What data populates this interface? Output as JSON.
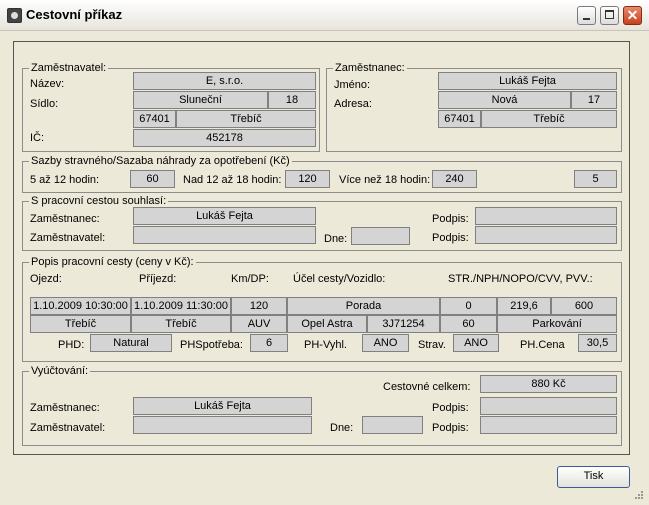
{
  "window": {
    "title": "Cestovní příkaz",
    "close_glyph": "✕"
  },
  "employer": {
    "legend": "Zaměstnavatel:",
    "name_label": "Název:",
    "name": "E, s.r.o.",
    "seat_label": "Sídlo:",
    "street": "Sluneční",
    "number": "18",
    "zip": "67401",
    "city": "Třebíč",
    "ico_label": "IČ:",
    "ico": "452178"
  },
  "employee": {
    "legend": "Zaměstnanec:",
    "name_label": "Jméno:",
    "name": "Lukáš Fejta",
    "address_label": "Adresa:",
    "street": "Nová",
    "number": "17",
    "zip": "67401",
    "city": "Třebíč"
  },
  "rates": {
    "legend": "Sazby stravného/Sazaba náhrady za opotřebení (Kč)",
    "r1_label": "5 až 12 hodin:",
    "r1": "60",
    "r2_label": "Nad 12 až 18 hodin:",
    "r2": "120",
    "r3_label": "Více než 18 hodin:",
    "r3": "240",
    "wear": "5"
  },
  "consent": {
    "legend": "S pracovní cestou souhlasí:",
    "employee_label": "Zaměstnanec:",
    "employee": "Lukáš Fejta",
    "employer_label": "Zaměstnavatel:",
    "employer": "",
    "date_label": "Dne:",
    "date": "",
    "sign1_label": "Podpis:",
    "sign2_label": "Podpis:"
  },
  "trip": {
    "legend": "Popis pracovní cesty (ceny v Kč):",
    "headers": {
      "departure": "Ojezd:",
      "arrival": "Příjezd:",
      "km": "Km/DP:",
      "purpose": "Účel cesty/Vozidlo:",
      "other": "STR./NPH/NOPO/CVV, PVV.:"
    },
    "row1": {
      "departure": "1.10.2009 10:30:00",
      "arrival": "1.10.2009 11:30:00",
      "km": "120",
      "purpose": "Porada",
      "str": "0",
      "nph": "219,6",
      "nopo": "600"
    },
    "row2": {
      "from": "Třebíč",
      "to": "Třebíč",
      "dp": "AUV",
      "car": "Opel Astra",
      "plate": "3J71254",
      "cvv": "60",
      "pvv": "Parkování"
    },
    "row3": {
      "phd_label": "PHD:",
      "phd": "Natural",
      "cons_label": "PHSpotřeba:",
      "cons": "6",
      "vyhl_label": "PH-Vyhl.",
      "vyhl": "ANO",
      "strav_label": "Strav.",
      "strav": "ANO",
      "price_label": "PH.Cena",
      "price": "30,5"
    }
  },
  "settlement": {
    "legend": "Vyúčtování:",
    "total_label": "Cestovné celkem:",
    "total": "880 Kč",
    "employee_label": "Zaměstnanec:",
    "employee": "Lukáš Fejta",
    "employer_label": "Zaměstnavatel:",
    "employer": "",
    "date_label": "Dne:",
    "date": "",
    "sign1_label": "Podpis:",
    "sign2_label": "Podpis:"
  },
  "footer": {
    "print_label": "Tisk"
  }
}
